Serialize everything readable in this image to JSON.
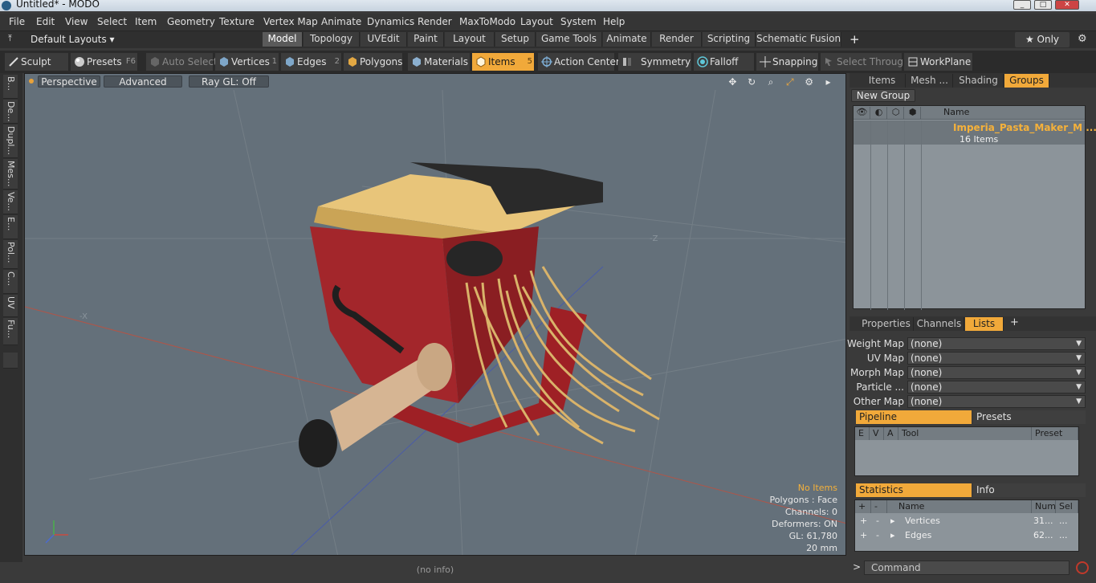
{
  "window": {
    "title": "Untitled* - MODO",
    "min": "_",
    "max": "□",
    "close": "✕"
  },
  "menu": [
    "File",
    "Edit",
    "View",
    "Select",
    "Item",
    "Geometry",
    "Texture",
    "Vertex Map",
    "Animate",
    "Dynamics",
    "Render",
    "MaxToModo",
    "Layout",
    "System",
    "Help"
  ],
  "layout_bar": {
    "default_layouts": "Default Layouts ▾",
    "tabs": [
      "Model",
      "Topology",
      "UVEdit",
      "Paint",
      "Layout",
      "Setup",
      "Game Tools",
      "Animate",
      "Render",
      "Scripting",
      "Schematic Fusion"
    ],
    "active_tab": "Model",
    "add": "+",
    "only": "★ Only"
  },
  "toolbar": {
    "sculpt": "Sculpt",
    "presets": "Presets",
    "presets_key": "F6",
    "auto_select": "Auto Select",
    "vertices": "Vertices",
    "vertices_num": "1",
    "edges": "Edges",
    "edges_num": "2",
    "polygons": "Polygons",
    "materials": "Materials",
    "items": "Items",
    "items_num": "5",
    "action_center": "Action Center",
    "symmetry": "Symmetry",
    "falloff": "Falloff",
    "snapping": "Snapping",
    "select_through": "Select Through",
    "workplane": "WorkPlane"
  },
  "left_tabs": [
    "B...",
    "De...",
    "Dupl...",
    "Mes...",
    "Ve...",
    "E...",
    "Pol...",
    "C...",
    "UV",
    "Fu..."
  ],
  "viewport": {
    "perspective": "Perspective",
    "advanced": "Advanced",
    "raygl": "Ray GL: Off",
    "tools": [
      "✥",
      "↻",
      "⌕",
      "⤢",
      "⚙",
      "▸"
    ],
    "axis_z": "-Z",
    "axis_x": "-X",
    "stats": {
      "items": "No Items",
      "polygons": "Polygons : Face",
      "channels": "Channels: 0",
      "deformers": "Deformers: ON",
      "gl": "GL: 61,780",
      "unit": "20 mm"
    },
    "status": "(no info)"
  },
  "right_panel": {
    "top_tabs": [
      "Items",
      "Mesh ...",
      "Shading",
      "Groups"
    ],
    "active_top_tab": "Groups",
    "new_group": "New Group",
    "name_header": "Name",
    "group_name": "Imperia_Pasta_Maker_M ...",
    "group_count": "16 Items",
    "mid_tabs": [
      "Properties",
      "Channels",
      "Lists"
    ],
    "active_mid_tab": "Lists",
    "add": "+",
    "lists": [
      {
        "label": "Weight Map",
        "value": "(none)"
      },
      {
        "label": "UV Map",
        "value": "(none)"
      },
      {
        "label": "Morph Map",
        "value": "(none)"
      },
      {
        "label": "Particle ...",
        "value": "(none)"
      },
      {
        "label": "Other Map",
        "value": "(none)"
      }
    ],
    "pipeline_tab": "Pipeline",
    "presets_tab": "Presets",
    "pipeline_headers": [
      "E",
      "V",
      "A",
      "Tool",
      "Preset"
    ],
    "statistics_tab": "Statistics",
    "info_tab": "Info",
    "stats_headers": [
      "+",
      "-",
      "Name",
      "Num",
      "Sel"
    ],
    "stats_rows": [
      {
        "plus": "+",
        "minus": "-",
        "name": "Vertices",
        "num": "31...",
        "sel": "..."
      },
      {
        "plus": "+",
        "minus": "-",
        "name": "Edges",
        "num": "62...",
        "sel": "..."
      }
    ],
    "command_placeholder": "Command",
    "command_arrow": ">"
  }
}
